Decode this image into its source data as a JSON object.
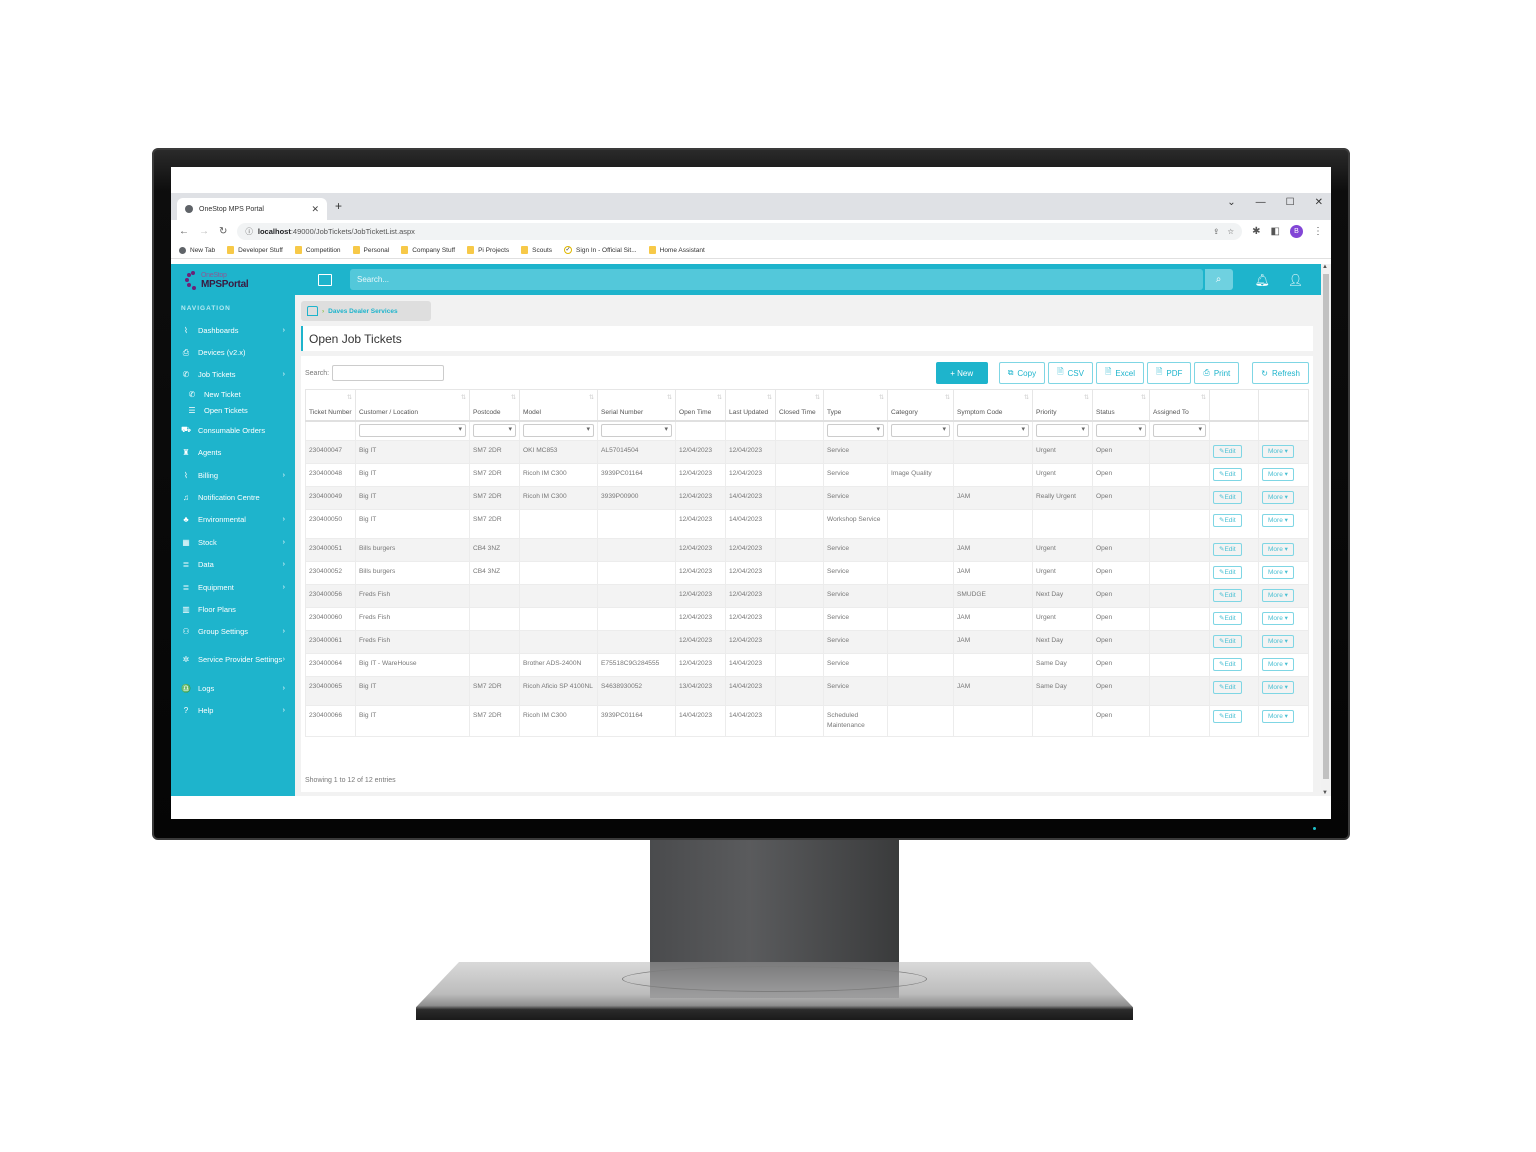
{
  "browser": {
    "tab_title": "OneStop MPS Portal",
    "url_host": "localhost",
    "url_path": ":49000/JobTickets/JobTicketList.aspx",
    "profile_initial": "B",
    "bookmarks": [
      "New Tab",
      "Developer Stuff",
      "Competition",
      "Personal",
      "Company Stuff",
      "Pi Projects",
      "Scouts",
      "Sign In - Official Sit...",
      "Home Assistant"
    ]
  },
  "app": {
    "logo_top": "OneStop",
    "logo_main": "MPSPortal",
    "search_placeholder": "Search...",
    "brand_color": "#1eb4cc"
  },
  "sidebar": {
    "heading": "NAVIGATION",
    "items": [
      {
        "label": "Dashboards",
        "icon": "chart-line-icon",
        "glyph": "⌇",
        "chevron": true
      },
      {
        "label": "Devices (v2.x)",
        "icon": "printer-icon",
        "glyph": "⎙",
        "chevron": false
      },
      {
        "label": "Job Tickets",
        "icon": "phone-icon",
        "glyph": "✆",
        "chevron": true
      },
      {
        "label": "New Ticket",
        "icon": "phone-plus-icon",
        "glyph": "✆",
        "chevron": false,
        "sub": true
      },
      {
        "label": "Open Tickets",
        "icon": "list-icon",
        "glyph": "☰",
        "chevron": false,
        "sub": true
      },
      {
        "label": "Consumable Orders",
        "icon": "cart-icon",
        "glyph": "⛟",
        "chevron": false
      },
      {
        "label": "Agents",
        "icon": "agent-icon",
        "glyph": "♜",
        "chevron": false
      },
      {
        "label": "Billing",
        "icon": "chart-line-icon",
        "glyph": "⌇",
        "chevron": true
      },
      {
        "label": "Notification Centre",
        "icon": "bell-icon",
        "glyph": "♫",
        "chevron": false
      },
      {
        "label": "Environmental",
        "icon": "trees-icon",
        "glyph": "♣",
        "chevron": true
      },
      {
        "label": "Stock",
        "icon": "stock-icon",
        "glyph": "▦",
        "chevron": true
      },
      {
        "label": "Data",
        "icon": "database-icon",
        "glyph": "≣",
        "chevron": true
      },
      {
        "label": "Equipment",
        "icon": "database-icon",
        "glyph": "≣",
        "chevron": true
      },
      {
        "label": "Floor Plans",
        "icon": "map-icon",
        "glyph": "▥",
        "chevron": false
      },
      {
        "label": "Group Settings",
        "icon": "group-icon",
        "glyph": "⚇",
        "chevron": true
      },
      {
        "label": "Service Provider Settings",
        "icon": "tools-icon",
        "glyph": "✲",
        "chevron": true,
        "tall": true
      },
      {
        "label": "Logs",
        "icon": "binoculars-icon",
        "glyph": "♎",
        "chevron": true
      },
      {
        "label": "Help",
        "icon": "help-icon",
        "glyph": "?",
        "chevron": true
      }
    ]
  },
  "breadcrumb": {
    "label": "Daves Dealer Services"
  },
  "page": {
    "title": "Open Job Tickets",
    "search_label": "Search:",
    "search_value": "",
    "buttons": {
      "new": "+ New",
      "copy": "Copy",
      "csv": "CSV",
      "excel": "Excel",
      "pdf": "PDF",
      "print": "Print",
      "refresh": "Refresh"
    },
    "footer": "Showing 1 to 12 of 12 entries",
    "edit_label": "Edit",
    "more_label": "More ▾"
  },
  "table": {
    "columns": [
      "Ticket Number",
      "Customer / Location",
      "Postcode",
      "Model",
      "Serial Number",
      "Open Time",
      "Last Updated",
      "Closed Time",
      "Type",
      "Category",
      "Symptom Code",
      "Priority",
      "Status",
      "Assigned To",
      "",
      ""
    ],
    "rows": [
      [
        "230400047",
        "Big IT",
        "SM7 2DR",
        "OKI MC853",
        "AL57014504",
        "12/04/2023",
        "12/04/2023",
        "",
        "Service",
        "",
        "",
        "Urgent",
        "Open",
        ""
      ],
      [
        "230400048",
        "Big IT",
        "SM7 2DR",
        "Ricoh IM C300",
        "3939PC01164",
        "12/04/2023",
        "12/04/2023",
        "",
        "Service",
        "Image Quality",
        "",
        "Urgent",
        "Open",
        ""
      ],
      [
        "230400049",
        "Big IT",
        "SM7 2DR",
        "Ricoh IM C300",
        "3939P00900",
        "12/04/2023",
        "14/04/2023",
        "",
        "Service",
        "",
        "JAM",
        "Really Urgent",
        "Open",
        ""
      ],
      [
        "230400050",
        "Big IT",
        "SM7 2DR",
        "",
        "",
        "12/04/2023",
        "14/04/2023",
        "",
        "Workshop Service",
        "",
        "",
        "",
        "",
        ""
      ],
      [
        "230400051",
        "Bills burgers",
        "CB4 3NZ",
        "",
        "",
        "12/04/2023",
        "12/04/2023",
        "",
        "Service",
        "",
        "JAM",
        "Urgent",
        "Open",
        ""
      ],
      [
        "230400052",
        "Bills burgers",
        "CB4 3NZ",
        "",
        "",
        "12/04/2023",
        "12/04/2023",
        "",
        "Service",
        "",
        "JAM",
        "Urgent",
        "Open",
        ""
      ],
      [
        "230400056",
        "Freds Fish",
        "",
        "",
        "",
        "12/04/2023",
        "12/04/2023",
        "",
        "Service",
        "",
        "SMUDGE",
        "Next Day",
        "Open",
        ""
      ],
      [
        "230400060",
        "Freds Fish",
        "",
        "",
        "",
        "12/04/2023",
        "12/04/2023",
        "",
        "Service",
        "",
        "JAM",
        "Urgent",
        "Open",
        ""
      ],
      [
        "230400061",
        "Freds Fish",
        "",
        "",
        "",
        "12/04/2023",
        "12/04/2023",
        "",
        "Service",
        "",
        "JAM",
        "Next Day",
        "Open",
        ""
      ],
      [
        "230400064",
        "Big IT - WareHouse",
        "",
        "Brother ADS-2400N",
        "E75518C9G284555",
        "12/04/2023",
        "14/04/2023",
        "",
        "Service",
        "",
        "",
        "Same Day",
        "Open",
        ""
      ],
      [
        "230400065",
        "Big IT",
        "SM7 2DR",
        "Ricoh Aficio SP 4100NL",
        "S4638930052",
        "13/04/2023",
        "14/04/2023",
        "",
        "Service",
        "",
        "JAM",
        "Same Day",
        "Open",
        ""
      ],
      [
        "230400066",
        "Big IT",
        "SM7 2DR",
        "Ricoh IM C300",
        "3939PC01164",
        "14/04/2023",
        "14/04/2023",
        "",
        "Scheduled Maintenance",
        "",
        "",
        "",
        "Open",
        ""
      ]
    ],
    "tall_rows": [
      3,
      10,
      11
    ],
    "filter_columns": [
      1,
      2,
      3,
      4,
      8,
      9,
      10,
      11,
      12,
      13
    ]
  }
}
